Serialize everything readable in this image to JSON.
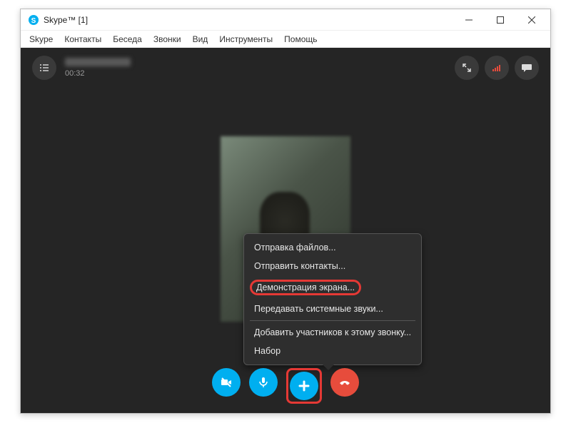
{
  "titlebar": {
    "title": "Skype™ [1]"
  },
  "menubar": {
    "items": [
      "Skype",
      "Контакты",
      "Беседа",
      "Звонки",
      "Вид",
      "Инструменты",
      "Помощь"
    ]
  },
  "call": {
    "timer": "00:32"
  },
  "popup": {
    "items": [
      "Отправка файлов...",
      "Отправить контакты...",
      "Демонстрация экрана...",
      "Передавать системные звуки...",
      "Добавить участников к этому звонку...",
      "Набор"
    ],
    "highlighted_index": 2
  },
  "icons": {
    "list": "list-icon",
    "fullscreen": "fullscreen-icon",
    "signal": "signal-icon",
    "chat": "chat-icon",
    "camera": "camera-off-icon",
    "mic": "mic-icon",
    "plus": "plus-icon",
    "hangup": "hangup-icon"
  },
  "colors": {
    "accent_blue": "#00aff0",
    "hangup_red": "#e74c3c",
    "highlight": "#e53935"
  }
}
